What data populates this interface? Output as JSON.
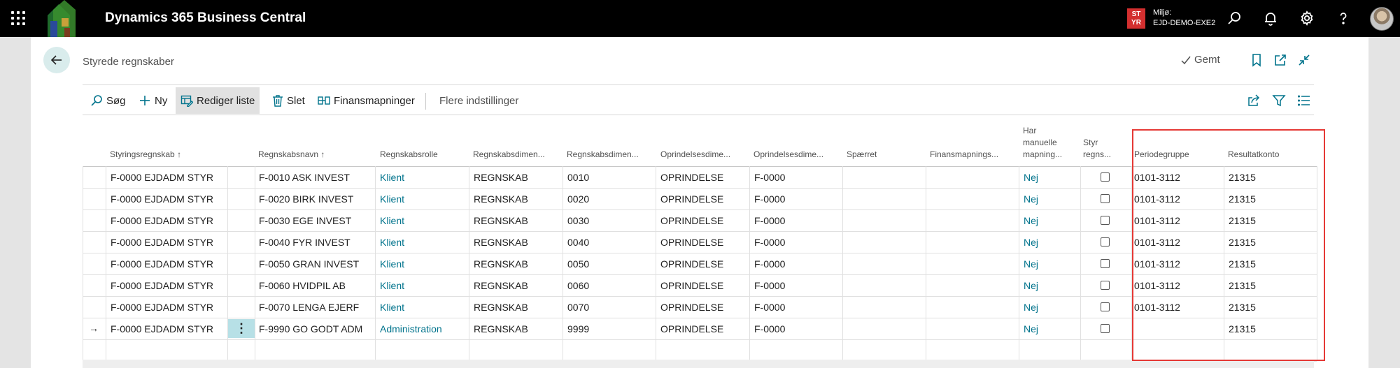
{
  "app": {
    "title": "Dynamics 365 Business Central",
    "env_badge_line1": "ST",
    "env_badge_line2": "YR",
    "env_label": "Miljø:",
    "env_name": "EJD-DEMO-EXE2",
    "badge_color": "#d32f2f"
  },
  "page": {
    "title": "Styrede regnskaber",
    "saved_label": "Gemt"
  },
  "actions": {
    "search": "Søg",
    "new": "Ny",
    "edit_list": "Rediger liste",
    "delete": "Slet",
    "finance_mappings": "Finansmapninger",
    "more_options": "Flere indstillinger"
  },
  "columns": {
    "styringsregnskab": "Styringsregnskab",
    "regnskabsnavn": "Regnskabsnavn",
    "regnskabsrolle": "Regnskabsrolle",
    "regnskabsdim1": "Regnskabsdimen...",
    "regnskabsdim2": "Regnskabsdimen...",
    "oprindelsesdim1": "Oprindelsesdime...",
    "oprindelsesdim2": "Oprindelsesdime...",
    "spaerret": "Spærret",
    "finansmapnings": "Finansmapnings...",
    "har_manuelle_1": "Har",
    "har_manuelle_2": "manuelle",
    "har_manuelle_3": "mapning...",
    "styr_regns_1": "Styr",
    "styr_regns_2": "regns...",
    "periodegruppe": "Periodegruppe",
    "resultatkonto": "Resultatkonto",
    "sort_indicator": "↑"
  },
  "rows": [
    {
      "styring": "F-0000 EJDADM STYR",
      "navn": "F-0010 ASK INVEST",
      "rolle": "Klient",
      "dim1": "REGNSKAB",
      "dim2": "0010",
      "opr1": "OPRINDELSE",
      "opr2": "F-0000",
      "manuel": "Nej",
      "periode": "0101-3112",
      "resultat": "21315"
    },
    {
      "styring": "F-0000 EJDADM STYR",
      "navn": "F-0020 BIRK INVEST",
      "rolle": "Klient",
      "dim1": "REGNSKAB",
      "dim2": "0020",
      "opr1": "OPRINDELSE",
      "opr2": "F-0000",
      "manuel": "Nej",
      "periode": "0101-3112",
      "resultat": "21315"
    },
    {
      "styring": "F-0000 EJDADM STYR",
      "navn": "F-0030 EGE INVEST",
      "rolle": "Klient",
      "dim1": "REGNSKAB",
      "dim2": "0030",
      "opr1": "OPRINDELSE",
      "opr2": "F-0000",
      "manuel": "Nej",
      "periode": "0101-3112",
      "resultat": "21315"
    },
    {
      "styring": "F-0000 EJDADM STYR",
      "navn": "F-0040 FYR INVEST",
      "rolle": "Klient",
      "dim1": "REGNSKAB",
      "dim2": "0040",
      "opr1": "OPRINDELSE",
      "opr2": "F-0000",
      "manuel": "Nej",
      "periode": "0101-3112",
      "resultat": "21315"
    },
    {
      "styring": "F-0000 EJDADM STYR",
      "navn": "F-0050 GRAN INVEST",
      "rolle": "Klient",
      "dim1": "REGNSKAB",
      "dim2": "0050",
      "opr1": "OPRINDELSE",
      "opr2": "F-0000",
      "manuel": "Nej",
      "periode": "0101-3112",
      "resultat": "21315"
    },
    {
      "styring": "F-0000 EJDADM STYR",
      "navn": "F-0060 HVIDPIL AB",
      "rolle": "Klient",
      "dim1": "REGNSKAB",
      "dim2": "0060",
      "opr1": "OPRINDELSE",
      "opr2": "F-0000",
      "manuel": "Nej",
      "periode": "0101-3112",
      "resultat": "21315"
    },
    {
      "styring": "F-0000 EJDADM STYR",
      "navn": "F-0070 LENGA EJERF",
      "rolle": "Klient",
      "dim1": "REGNSKAB",
      "dim2": "0070",
      "opr1": "OPRINDELSE",
      "opr2": "F-0000",
      "manuel": "Nej",
      "periode": "0101-3112",
      "resultat": "21315"
    },
    {
      "styring": "F-0000 EJDADM STYR",
      "navn": "F-9990 GO GODT ADM",
      "rolle": "Administration",
      "dim1": "REGNSKAB",
      "dim2": "9999",
      "opr1": "OPRINDELSE",
      "opr2": "F-0000",
      "manuel": "Nej",
      "periode": "",
      "resultat": "21315"
    }
  ],
  "highlight_color": "#e53935"
}
